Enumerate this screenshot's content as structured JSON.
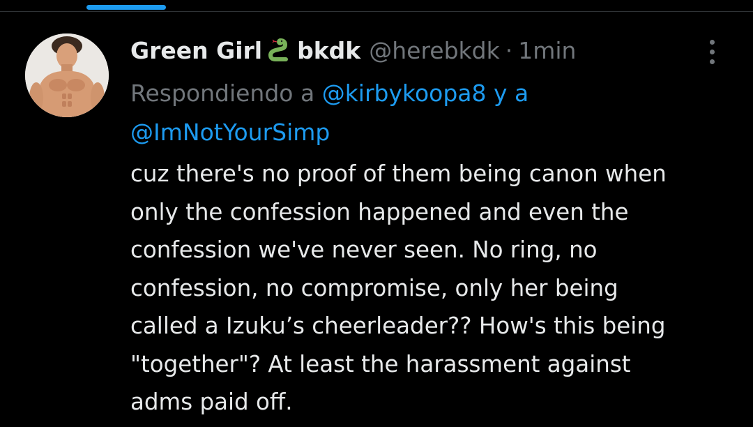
{
  "tweet": {
    "author": {
      "display_name": "Green Girl",
      "emoji": "snake-emoji",
      "tag": "bkdk",
      "handle": "@herebkdk"
    },
    "separator": "·",
    "time": "1min",
    "reply_context": {
      "prefix": "Respondiendo a",
      "mention_1": "@kirbykoopa8",
      "conjunction": "y a",
      "mention_2": "@ImNotYourSimp"
    },
    "text_lines": [
      "cuz there's no proof of them being canon when",
      "only the confession happened and even the",
      "confession we've never seen. No ring, no",
      "confession, no compromise, only her being",
      "called a Izuku’s cheerleader?? How's this being",
      "\"together\"? At least the harassment against",
      "adms paid off."
    ]
  },
  "colors": {
    "background": "#000000",
    "text_primary": "#e7e9ea",
    "text_secondary": "#71767b",
    "accent": "#1d9bf0",
    "divider": "#2f3336"
  }
}
